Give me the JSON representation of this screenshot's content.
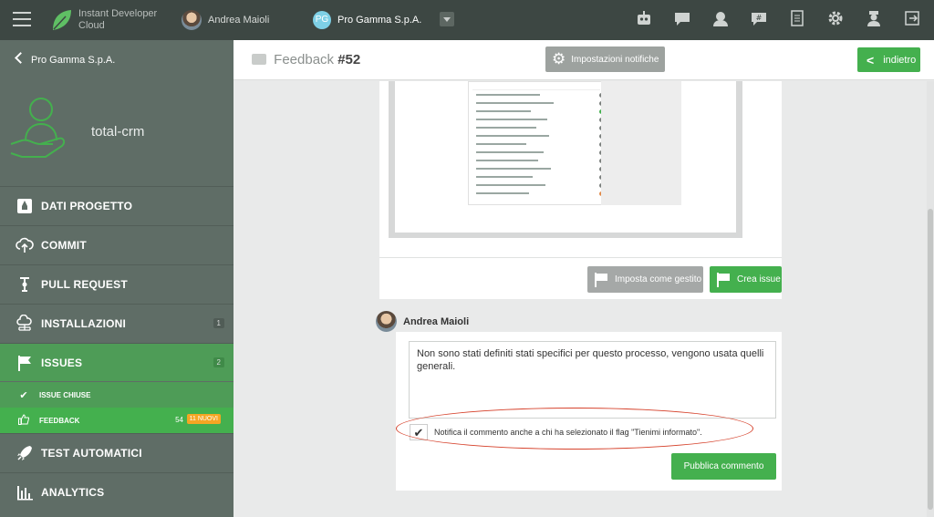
{
  "topbar": {
    "brand_line1": "Instant Developer",
    "brand_line2": "Cloud",
    "user_name": "Andrea Maioli",
    "project_initials": "PG",
    "project_name": "Pro Gamma S.p.A.",
    "icons": [
      "bot-icon",
      "chat-icon",
      "support-icon",
      "chat-hash-icon",
      "document-icon",
      "gear-icon",
      "admin-icon",
      "logout-icon"
    ]
  },
  "sidebar": {
    "back_label": "Pro Gamma S.p.A.",
    "project_name": "total-crm",
    "items": [
      {
        "label": "DATI PROGETTO",
        "icon": "rocket-icon"
      },
      {
        "label": "COMMIT",
        "icon": "cloud-upload-icon"
      },
      {
        "label": "PULL REQUEST",
        "icon": "pull-request-icon"
      },
      {
        "label": "INSTALLAZIONI",
        "icon": "cloud-network-icon",
        "count": "1"
      },
      {
        "label": "ISSUES",
        "icon": "flag-icon",
        "count": "2"
      },
      {
        "label": "TEST AUTOMATICI",
        "icon": "rocket-launch-icon"
      },
      {
        "label": "ANALYTICS",
        "icon": "bar-chart-icon"
      }
    ],
    "sub_items": [
      {
        "label": "ISSUE CHIUSE",
        "icon": "check-icon"
      },
      {
        "label": "FEEDBACK",
        "icon": "thumbs-up-icon",
        "count": "54",
        "new_badge": "11 NUOVI"
      }
    ]
  },
  "header": {
    "title_prefix": "Feedback",
    "title_number": "#52",
    "notif_button": "Impostazioni notifiche",
    "back_button": "indietro"
  },
  "feedback_card": {
    "btn_gestito": "Imposta come gestito",
    "btn_issue": "Crea issue"
  },
  "comment": {
    "author": "Andrea Maioli",
    "text": "Non sono stati definiti stati specifici per questo processo, vengono usata quelli generali.",
    "notify_label": "Notifica il commento anche a chi ha selezionato il flag \"Tienimi informato\".",
    "notify_checked": true,
    "publish_button": "Pubblica commento"
  },
  "colors": {
    "topbar": "#3d4743",
    "sidebar": "#5f6d66",
    "accent_green": "#44b04e",
    "badge_orange": "#f5a623",
    "highlight_red": "#d6432d"
  }
}
